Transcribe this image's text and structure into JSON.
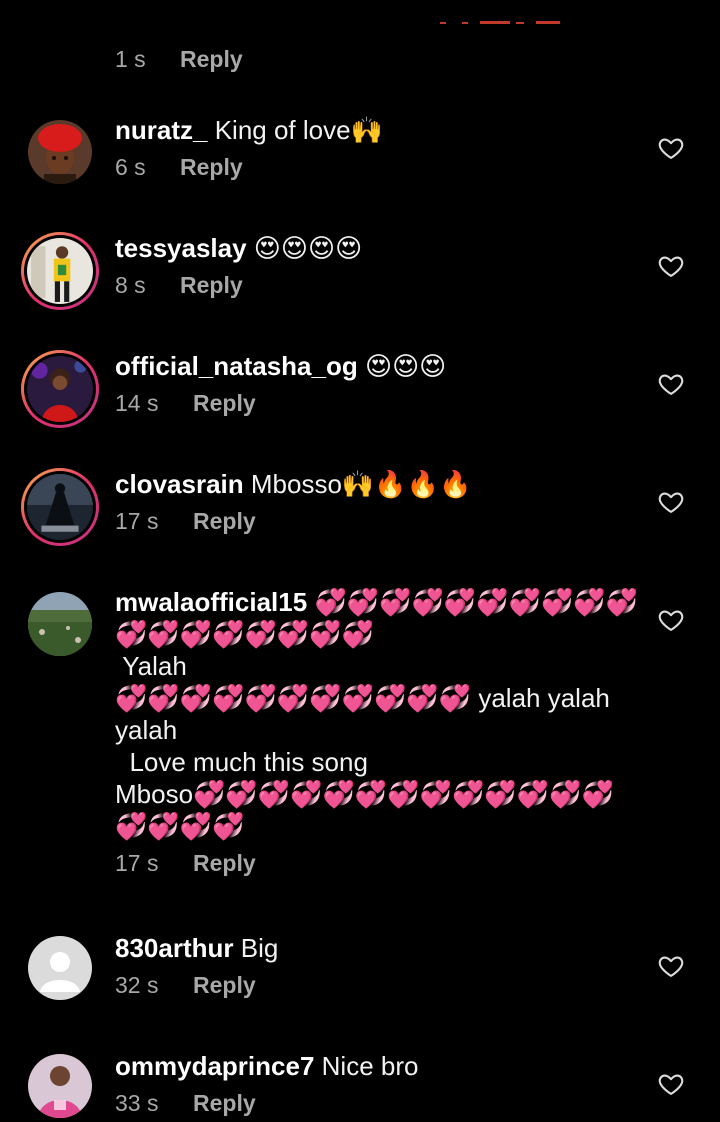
{
  "comments": [
    {
      "username": "",
      "text": "",
      "time": "1 s",
      "reply_label": "Reply",
      "avatar": "none"
    },
    {
      "username": "nuratz_",
      "text": "King of love🙌",
      "time": "6 s",
      "reply_label": "Reply",
      "avatar": "woman-red-headwrap",
      "story_ring": false
    },
    {
      "username": "tessyaslay",
      "text": "😍😍😍😍",
      "time": "8 s",
      "reply_label": "Reply",
      "avatar": "woman-yellow-outfit",
      "story_ring": true
    },
    {
      "username": "official_natasha_og",
      "text": "😍😍😍",
      "time": "14 s",
      "reply_label": "Reply",
      "avatar": "woman-red-dress",
      "story_ring": true
    },
    {
      "username": "clovasrain",
      "text": "Mbosso🙌🔥🔥🔥",
      "time": "17 s",
      "reply_label": "Reply",
      "avatar": "dark-figure-artwork",
      "story_ring": true
    },
    {
      "username": "mwalaofficial15",
      "text": "💞💞💞💞💞💞💞💞💞💞💞💞💞💞💞💞💞💞\n Yalah\n💞💞💞💞💞💞💞💞💞💞💞 yalah yalah yalah\n  Love much this song\nMboso💞💞💞💞💞💞💞💞💞💞💞💞💞💞💞💞💞",
      "time": "17 s",
      "reply_label": "Reply",
      "avatar": "landscape-photo",
      "story_ring": false
    },
    {
      "username": "830arthur",
      "text": "Big",
      "time": "32 s",
      "reply_label": "Reply",
      "avatar": "default-person",
      "story_ring": false
    },
    {
      "username": "ommydaprince7",
      "text": "Nice bro",
      "time": "33 s",
      "reply_label": "Reply",
      "avatar": "person-pink-shirt",
      "story_ring": false
    }
  ],
  "icons": {
    "like": "heart-outline-icon"
  },
  "colors": {
    "background": "#000000",
    "primary_text": "#f5f5f5",
    "secondary_text": "#a8a8a8",
    "story_ring": "#e1306c"
  }
}
